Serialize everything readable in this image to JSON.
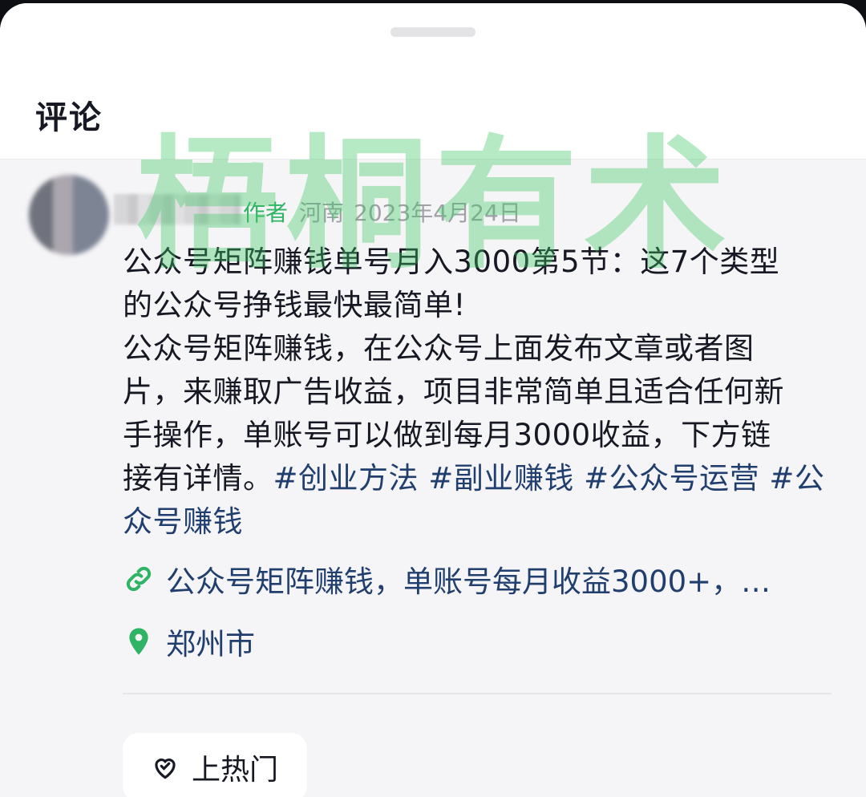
{
  "sheet": {
    "title": "评论"
  },
  "comment": {
    "author_badge": "作者",
    "region": "河南",
    "date": "2023年4月24日",
    "text_lines": [
      "公众号矩阵赚钱单号月入3000第5节：这7个类型",
      "的公众号挣钱最快最简单!",
      "公众号矩阵赚钱，在公众号上面发布文章或者图",
      "片，来赚取广告收益，项目非常简单且适合任何新",
      "手操作，单账号可以做到每月3000收益，下方链",
      "接有详情。"
    ],
    "hashtags": [
      "#创业方法",
      "#副业赚钱",
      "#公众号运营",
      "#公众号赚钱"
    ],
    "link_text": "公众号矩阵赚钱，单账号每月收益3000+，…",
    "location": "郑州市"
  },
  "actions": {
    "hot_label": "上热门"
  },
  "watermark": "梧桐有术",
  "colors": {
    "accent_green": "#2fb364",
    "link_blue": "#213f6e",
    "text": "#161823"
  },
  "icons": [
    "link-icon",
    "location-pin-icon",
    "heart-boost-icon"
  ]
}
